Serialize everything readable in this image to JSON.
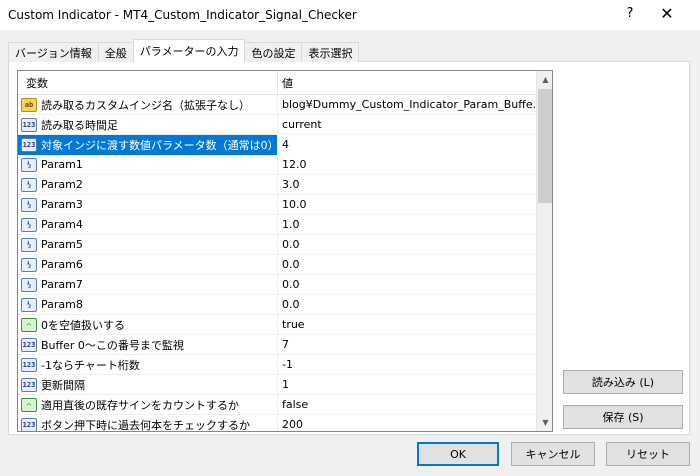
{
  "window": {
    "title": "Custom Indicator - MT4_Custom_Indicator_Signal_Checker",
    "help_glyph": "?",
    "close_glyph": "✕"
  },
  "tabs": [
    {
      "label": "バージョン情報",
      "active": false
    },
    {
      "label": "全般",
      "active": false
    },
    {
      "label": "パラメーターの入力",
      "active": true
    },
    {
      "label": "色の設定",
      "active": false
    },
    {
      "label": "表示選択",
      "active": false
    }
  ],
  "grid": {
    "headers": {
      "variable": "変数",
      "value": "値"
    },
    "rows": [
      {
        "icon": "ab",
        "name": "読み取るカスタムインジ名（拡張子なし）",
        "value": "blog¥Dummy_Custom_Indicator_Param_Buffe..."
      },
      {
        "icon": "123",
        "name": "読み取る時間足",
        "value": "current"
      },
      {
        "icon": "123",
        "name": "対象インジに渡す数値パラメータ数（通常は0）",
        "value": "4"
      },
      {
        "icon": "V2",
        "name": "Param1",
        "value": "12.0"
      },
      {
        "icon": "V2",
        "name": "Param2",
        "value": "3.0"
      },
      {
        "icon": "V2",
        "name": "Param3",
        "value": "10.0"
      },
      {
        "icon": "V2",
        "name": "Param4",
        "value": "1.0"
      },
      {
        "icon": "V2",
        "name": "Param5",
        "value": "0.0"
      },
      {
        "icon": "V2",
        "name": "Param6",
        "value": "0.0"
      },
      {
        "icon": "V2",
        "name": "Param7",
        "value": "0.0"
      },
      {
        "icon": "V2",
        "name": "Param8",
        "value": "0.0"
      },
      {
        "icon": "bool",
        "name": "0を空値扱いする",
        "value": "true"
      },
      {
        "icon": "123",
        "name": "Buffer 0〜この番号まで監視",
        "value": "7"
      },
      {
        "icon": "123",
        "name": "-1ならチャート桁数",
        "value": "-1"
      },
      {
        "icon": "123",
        "name": "更新間隔",
        "value": "1"
      },
      {
        "icon": "bool",
        "name": "適用直後の既存サインをカウントするか",
        "value": "false"
      },
      {
        "icon": "123",
        "name": "ボタン押下時に過去何本をチェックするか",
        "value": "200"
      }
    ],
    "selected_index": 2
  },
  "buttons": {
    "load": "読み込み (L)",
    "save": "保存 (S)",
    "ok": "OK",
    "cancel": "キャンセル",
    "reset": "リセット"
  },
  "colors": {
    "selection": "#0078d7",
    "default_button_border": "#0078d7"
  }
}
